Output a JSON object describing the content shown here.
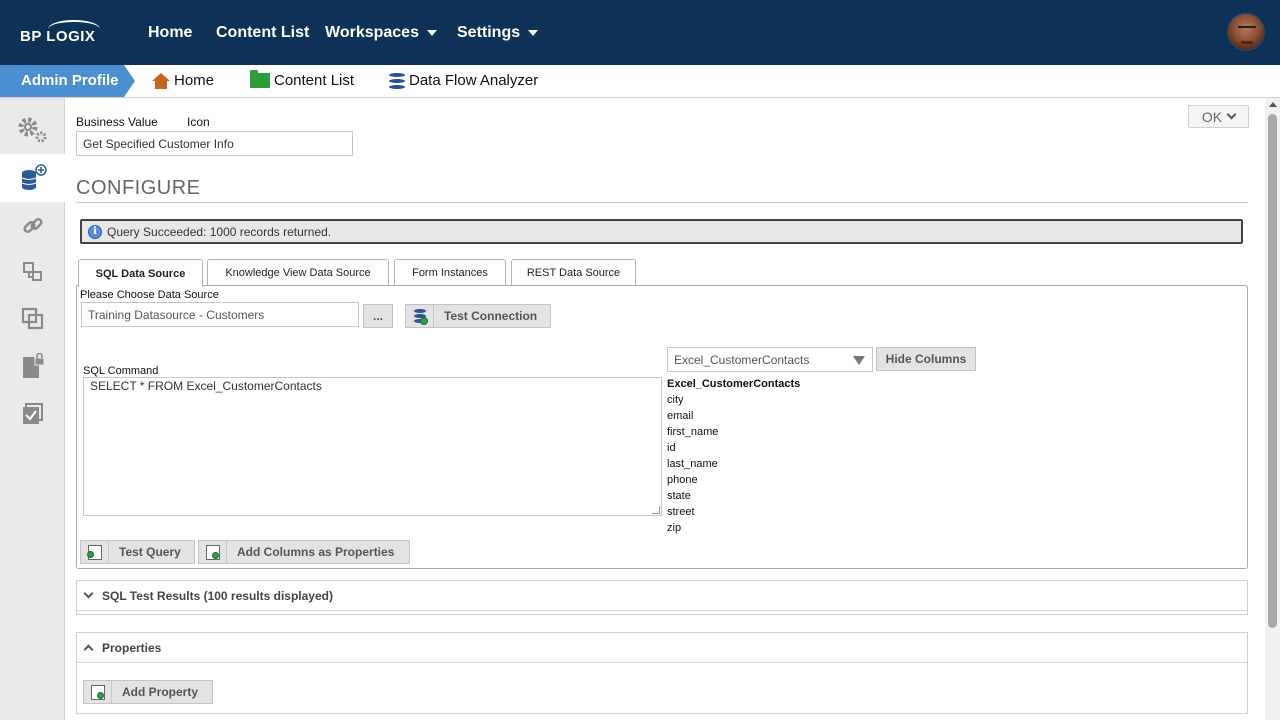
{
  "topnav": {
    "logo_text": "BP LOGIX",
    "items": [
      {
        "label": "Home"
      },
      {
        "label": "Content List"
      },
      {
        "label": "Workspaces"
      },
      {
        "label": "Settings"
      }
    ]
  },
  "breadcrumb": {
    "profile": "Admin Profile",
    "links": [
      {
        "label": "Home",
        "icon": "home-icon"
      },
      {
        "label": "Content List",
        "icon": "folder-icon"
      },
      {
        "label": "Data Flow Analyzer",
        "icon": "database-icon"
      }
    ]
  },
  "sidebar": {
    "items": [
      {
        "icon": "gears-icon",
        "active": false
      },
      {
        "icon": "database-add-icon",
        "active": true
      },
      {
        "icon": "link-icon",
        "active": false
      },
      {
        "icon": "hierarchy-icon",
        "active": false
      },
      {
        "icon": "copy-icon",
        "active": false
      },
      {
        "icon": "locked-document-icon",
        "active": false
      },
      {
        "icon": "checkbox-icon",
        "active": false
      }
    ]
  },
  "header": {
    "business_value_label": "Business Value",
    "icon_label": "Icon",
    "business_value": "Get Specified Customer Info",
    "ok_label": "OK"
  },
  "configure": {
    "title": "CONFIGURE",
    "status_message": "Query Succeeded: 1000 records returned.",
    "tabs": [
      {
        "label": "SQL Data Source",
        "active": true
      },
      {
        "label": "Knowledge View Data Source",
        "active": false
      },
      {
        "label": "Form Instances",
        "active": false
      },
      {
        "label": "REST Data Source",
        "active": false
      }
    ],
    "datasource_label": "Please Choose Data Source",
    "datasource_value": "Training Datasource - Customers",
    "browse_label": "...",
    "test_connection_label": "Test Connection",
    "sql_command_label": "SQL Command",
    "sql_command": "SELECT * FROM Excel_CustomerContacts",
    "table_select": "Excel_CustomerContacts",
    "hide_columns_label": "Hide Columns",
    "columns_header": "Excel_CustomerContacts",
    "columns": [
      "city",
      "email",
      "first_name",
      "id",
      "last_name",
      "phone",
      "state",
      "street",
      "zip"
    ],
    "test_query_label": "Test Query",
    "add_columns_label": "Add Columns as Properties"
  },
  "sql_results": {
    "title": "SQL Test Results (100 results displayed)"
  },
  "properties": {
    "title": "Properties",
    "add_property_label": "Add Property"
  }
}
